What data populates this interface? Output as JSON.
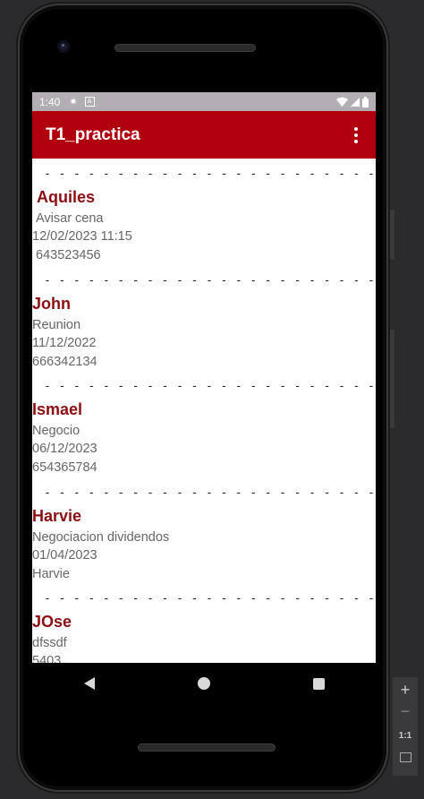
{
  "status_bar": {
    "time": "1:40"
  },
  "app_bar": {
    "title": "T1_practica"
  },
  "divider": "- - - - - - - - - - - - - - - - - - - - - - - - - - -",
  "contacts": [
    {
      "name": "Aquiles",
      "description": "Avisar cena",
      "date": "12/02/2023 11:15",
      "phone": "643523456"
    },
    {
      "name": "John",
      "description": "Reunion",
      "date": "11/12/2022",
      "phone": "666342134"
    },
    {
      "name": "Ismael",
      "description": "Negocio",
      "date": "06/12/2023",
      "phone": "654365784"
    },
    {
      "name": "Harvie",
      "description": "Negociacion dividendos",
      "date": "01/04/2023",
      "phone": "Harvie"
    },
    {
      "name": "JOse",
      "description": "dfssdf",
      "date": "5403",
      "phone": ""
    }
  ],
  "zoom_panel": {
    "zoom_in": "+",
    "zoom_out": "−",
    "actual_size": "1:1"
  },
  "icons": {
    "status": [
      "gear-icon",
      "a-box-icon",
      "wifi-icon",
      "signal-icon",
      "battery-icon"
    ],
    "app_bar": [
      "overflow-menu-icon"
    ],
    "nav": [
      "back-icon",
      "home-icon",
      "recents-icon"
    ]
  }
}
